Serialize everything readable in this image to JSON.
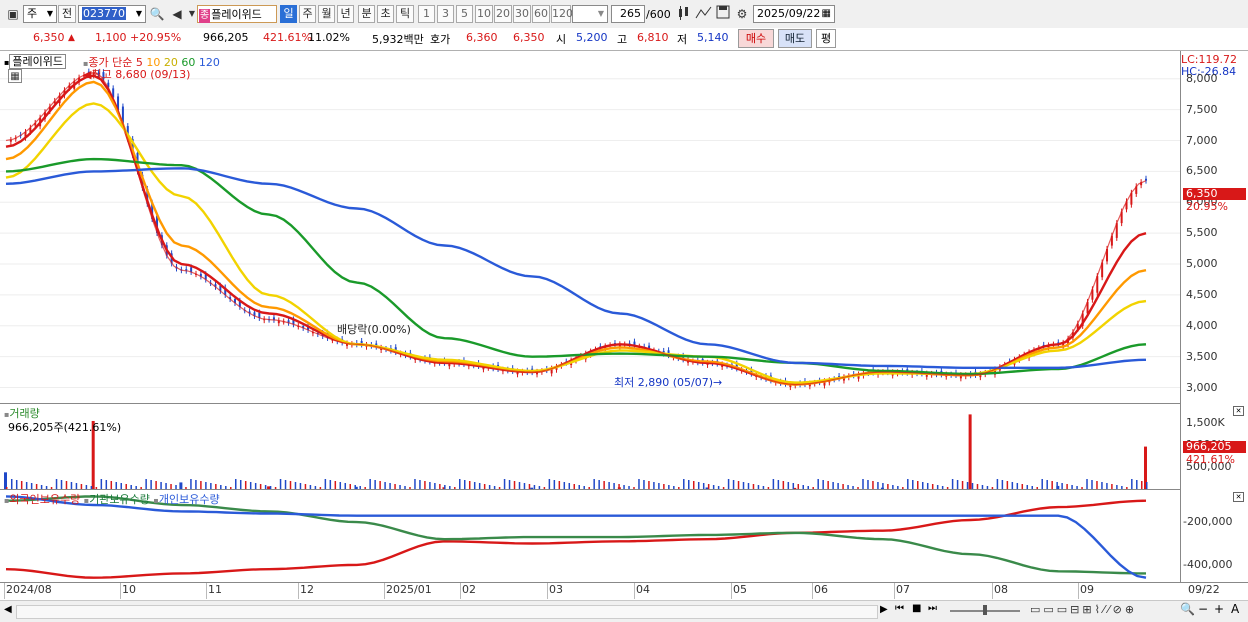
{
  "toolbar": {
    "type_value": "주",
    "prev_label": "전",
    "code_value": "023770",
    "stock_name": "플레이위드",
    "stock_badge": "종",
    "period_tabs": [
      "일",
      "주",
      "월",
      "년",
      "분",
      "초",
      "틱"
    ],
    "interval_buttons": [
      "1",
      "3",
      "5",
      "10",
      "20",
      "30",
      "60",
      "120"
    ],
    "count_value": "265",
    "count_total": "/600",
    "date_value": "2025/09/22"
  },
  "quote": {
    "price": "6,350",
    "change": "1,100",
    "change_pct": "+20.95%",
    "volume": "966,205",
    "volume_ratio": "421.61%",
    "turnover_rate": "11.02%",
    "amount": "5,932백만",
    "ask_label": "호가",
    "ask": "6,360",
    "bid": "6,350",
    "open_label": "시",
    "open": "5,200",
    "high_label": "고",
    "high": "6,810",
    "low_label": "저",
    "low": "5,140",
    "buy_label": "매수",
    "sell_label": "매도",
    "eval_label": "평"
  },
  "price_panel": {
    "stock_name": "플레이위드",
    "legend_prefix": "종가 단순",
    "ma_labels": [
      "5",
      "10",
      "20",
      "60",
      "120"
    ],
    "ma_colors": [
      "#d81818",
      "#ff9900",
      "#f2d300",
      "#1a9a2a",
      "#2a5ad8"
    ],
    "high_annotation": "최고 8,680 (09/13)",
    "low_annotation": "최저 2,890 (05/07)",
    "dividend_annotation": "배당락(0.00%)",
    "lc": "LC:119.72",
    "hc": "HC:-26.84",
    "current_price_tag": "6,350",
    "current_pct_tag": "20.95%",
    "y_ticks": [
      "8,000",
      "7,500",
      "7,000",
      "6,500",
      "6,000",
      "5,500",
      "5,000",
      "4,500",
      "4,000",
      "3,500",
      "3,000"
    ]
  },
  "volume_panel": {
    "title": "거래량",
    "value_label": "966,205주(421.61%)",
    "y_ticks": [
      "1,500K",
      "1,000K",
      "500,000"
    ],
    "current_tag": "966,205",
    "current_pct": "421.61%"
  },
  "holding_panel": {
    "titles": [
      "외국인보유수량",
      "기관보유수량",
      "개인보유수량"
    ],
    "title_colors": [
      "#d81818",
      "#1a7a3a",
      "#2a5ad8"
    ],
    "y_ticks": [
      "-200,000",
      "-400,000"
    ]
  },
  "x_axis": [
    "2024/08",
    "10",
    "11",
    "12",
    "2025/01",
    "02",
    "03",
    "04",
    "05",
    "06",
    "07",
    "08",
    "09",
    "09/22"
  ],
  "chart_data": [
    {
      "type": "line",
      "title": "플레이위드",
      "xlabel": "",
      "ylabel": "",
      "ylim": [
        2750,
        8450
      ],
      "categories": [
        "2024-08",
        "2024-09",
        "2024-10",
        "2024-11",
        "2024-12",
        "2025-01",
        "2025-02",
        "2025-03",
        "2025-04",
        "2025-05",
        "2025-06",
        "2025-07",
        "2025-08",
        "2025-09-22"
      ],
      "series": [
        {
          "name": "종가",
          "values": [
            7000,
            8100,
            4900,
            4100,
            3700,
            3400,
            3250,
            3700,
            3400,
            3050,
            3250,
            3200,
            3700,
            6350
          ]
        },
        {
          "name": "5",
          "values": [
            6900,
            8050,
            5000,
            4200,
            3700,
            3400,
            3250,
            3700,
            3400,
            3050,
            3250,
            3200,
            3700,
            5500
          ]
        },
        {
          "name": "10",
          "values": [
            6700,
            7950,
            5300,
            4300,
            3700,
            3420,
            3260,
            3650,
            3420,
            3050,
            3250,
            3200,
            3650,
            4900
          ]
        },
        {
          "name": "20",
          "values": [
            6400,
            7600,
            6100,
            4500,
            3700,
            3450,
            3270,
            3600,
            3500,
            3080,
            3230,
            3220,
            3600,
            4400
          ]
        },
        {
          "name": "60",
          "values": [
            6500,
            6700,
            6600,
            5800,
            4700,
            3800,
            3500,
            3550,
            3500,
            3400,
            3270,
            3220,
            3300,
            3700
          ]
        },
        {
          "name": "120",
          "values": [
            6300,
            6500,
            6550,
            6300,
            5900,
            5300,
            4800,
            4200,
            3700,
            3400,
            3350,
            3320,
            3320,
            3450
          ]
        }
      ]
    },
    {
      "type": "bar",
      "title": "거래량",
      "ylim": [
        0,
        1800000
      ],
      "categories": [
        "2024-08",
        "2024-09",
        "2024-10",
        "2024-11",
        "2024-12",
        "2025-01",
        "2025-02",
        "2025-03",
        "2025-04",
        "2025-05",
        "2025-06",
        "2025-07",
        "2025-08",
        "2025-09-22"
      ],
      "values": [
        380000,
        1550000,
        150000,
        60000,
        50000,
        40000,
        30000,
        40000,
        35000,
        25000,
        30000,
        1700000,
        70000,
        966205
      ]
    },
    {
      "type": "line",
      "title": "보유수량",
      "ylim": [
        -480000,
        -50000
      ],
      "categories": [
        "2024-08",
        "2024-09",
        "2024-10",
        "2024-11",
        "2024-12",
        "2025-01",
        "2025-02",
        "2025-03",
        "2025-04",
        "2025-05",
        "2025-06",
        "2025-07",
        "2025-08",
        "2025-09-22"
      ],
      "series": [
        {
          "name": "외국인보유수량",
          "values": [
            -420000,
            -460000,
            -440000,
            -420000,
            -400000,
            -290000,
            -300000,
            -290000,
            -280000,
            -250000,
            -240000,
            -190000,
            -130000,
            -100000
          ]
        },
        {
          "name": "기관보유수량",
          "values": [
            -100000,
            -80000,
            -120000,
            -150000,
            -200000,
            -280000,
            -270000,
            -270000,
            -260000,
            -250000,
            -280000,
            -350000,
            -430000,
            -440000
          ]
        },
        {
          "name": "개인보유수량",
          "values": [
            -80000,
            -120000,
            -150000,
            -160000,
            -170000,
            -170000,
            -170000,
            -170000,
            -170000,
            -170000,
            -170000,
            -170000,
            -170000,
            -460000
          ]
        }
      ]
    }
  ]
}
